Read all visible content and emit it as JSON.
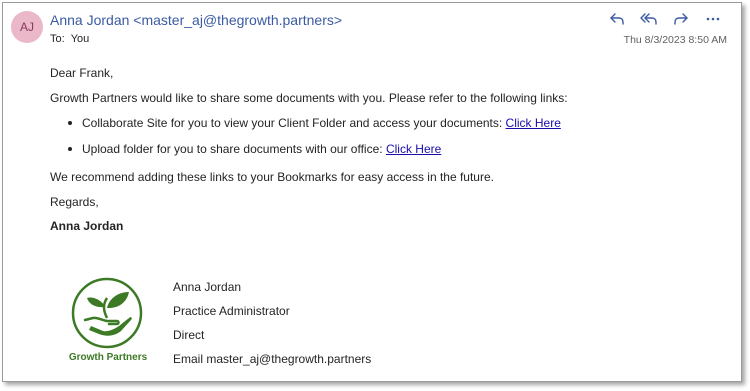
{
  "header": {
    "avatar_initials": "AJ",
    "avatar_color": "#eab8c8",
    "sender": "Anna Jordan <master_aj@thegrowth.partners>",
    "to_label": "To:",
    "to_value": "You",
    "date": "Thu 8/3/2023 8:50 AM",
    "actions": [
      "reply-icon",
      "reply-all-icon",
      "forward-icon",
      "more-icon"
    ]
  },
  "body": {
    "greeting": "Dear Frank,",
    "intro": "Growth Partners would like to share some documents with you. Please refer to the following links:",
    "links": [
      {
        "text": "Collaborate Site for you to view your Client Folder and access your documents: ",
        "link": "Click Here"
      },
      {
        "text": "Upload folder for you to share documents with our office: ",
        "link": "Click Here"
      }
    ],
    "recommend": "We recommend adding these links to your Bookmarks for easy access in the future.",
    "regards": "Regards,",
    "name": "Anna Jordan"
  },
  "signature": {
    "logo_text": "Growth Partners",
    "logo_color": "#3d7a25",
    "name": "Anna Jordan",
    "title": "Practice Administrator",
    "direct": "Direct",
    "email": "Email master_aj@thegrowth.partners"
  }
}
